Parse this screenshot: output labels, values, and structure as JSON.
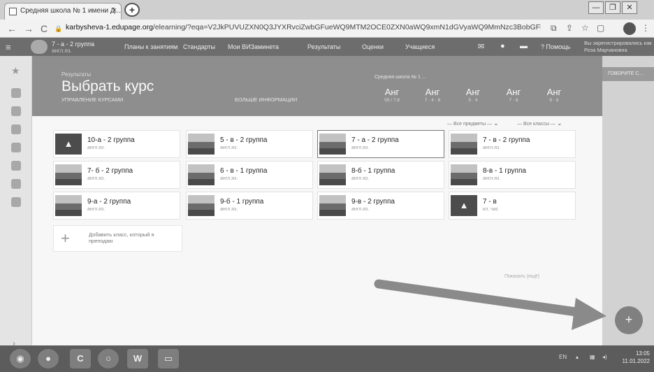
{
  "browser": {
    "tab_title": "Средняя школа № 1 имени Д...",
    "tab_close": "×",
    "new_tab": "+",
    "url_domain": "karbysheva-1.edupage.org",
    "url_path": "/elearning/?eqa=V2JkPUVUZXN0Q3JYXRvciZwbGFueWQ9MTM2OCE0ZXN0aWQ9xmN1dGVyaWQ9MmNzc3BobGFkJ3RhbnQ9dDVzdHM...",
    "back": "←",
    "forward": "→",
    "reload": "C",
    "lock": "🔒",
    "window_controls": [
      "—",
      "❐",
      "✕"
    ]
  },
  "app_header": {
    "menu": "≡",
    "group_line1": "7 - а - 2 группа",
    "group_line2": "англ.яз.",
    "items": [
      "Планы к занятиям",
      "Стандарты",
      "Мои ВИЗаминета",
      "Результаты",
      "Оценки",
      "Учащиеся"
    ],
    "help": "Помощь",
    "user_line1": "Вы зарегистрировались как",
    "user_line2": "Роза Марчановна"
  },
  "banner": {
    "small": "Результаты",
    "title": "Выбрать курс",
    "manage": "УПРАВЛЕНИЕ КУРСАМИ",
    "more": "БОЛЬШЕ ИНФОРМАЦИИ",
    "school": "Средняя школа № 1 ...",
    "stats": [
      {
        "value": "Анг",
        "sub": "5б / 7.8"
      },
      {
        "value": "Анг",
        "sub": "7 · 4 · 8"
      },
      {
        "value": "Анг",
        "sub": "5 · 4"
      },
      {
        "value": "Анг",
        "sub": "7 · 8"
      },
      {
        "value": "Анг",
        "sub": "8 · 6"
      }
    ]
  },
  "right_panel": {
    "header": "ГОВОРИТЕ С..."
  },
  "filters": {
    "subjects": "— Все предметы —",
    "classes": "— Все классы —",
    "caret": "⌄"
  },
  "courses": [
    {
      "name": "10-а - 2 группа",
      "subject": "англ.яз."
    },
    {
      "name": "5 - в - 2 группа",
      "subject": "англ.яз."
    },
    {
      "name": "7 - а - 2 группа",
      "subject": "англ.яз."
    },
    {
      "name": "7 - в - 2 группа",
      "subject": "англ.яз."
    },
    {
      "name": "7- б - 2 группа",
      "subject": "англ.яз."
    },
    {
      "name": "6 - в - 1 группа",
      "subject": "англ.яз."
    },
    {
      "name": "8-б - 1 группа",
      "subject": "англ.яз."
    },
    {
      "name": "8-в - 1 группа",
      "subject": "англ.яз."
    },
    {
      "name": "9-а - 2 группа",
      "subject": "англ.яз."
    },
    {
      "name": "9-б - 1 группа",
      "subject": "англ.яз."
    },
    {
      "name": "9-в - 2 группа",
      "subject": "англ.яз."
    },
    {
      "name": "7 - в",
      "subject": "кл. час"
    }
  ],
  "add_class": {
    "plus": "+",
    "text": "Добавить класс, который я преподаю"
  },
  "hidden_link": "Показать (ещё)",
  "fab": "+",
  "taskbar": {
    "lang": "EN",
    "time": "13:05",
    "date": "11.01.2022"
  }
}
